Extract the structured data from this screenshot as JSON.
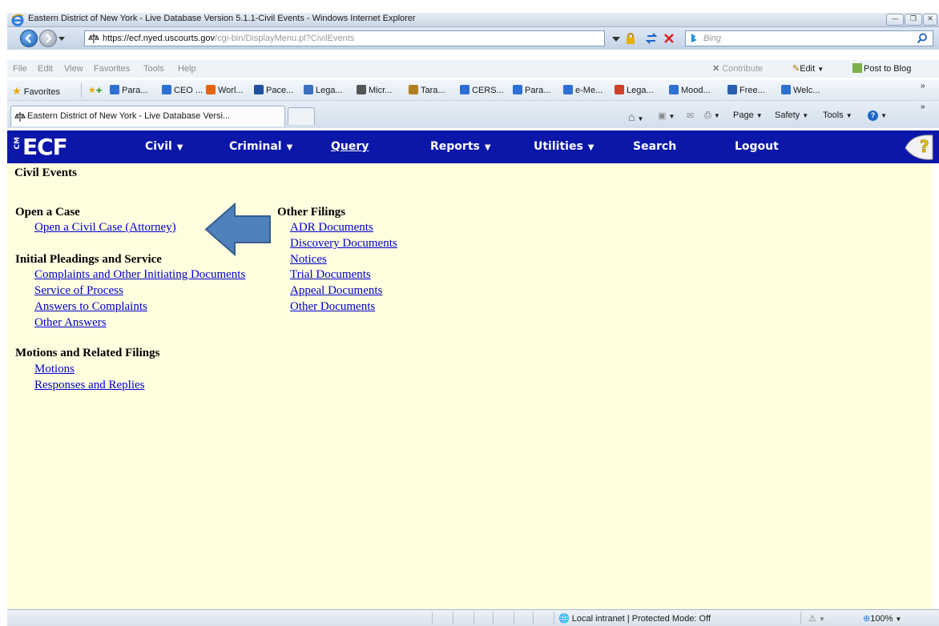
{
  "window": {
    "title": "Eastern District of New York - Live Database Version 5.1.1-Civil Events - Windows Internet Explorer"
  },
  "address": {
    "url_host": "https://ecf.nyed.uscourts.gov",
    "url_path": "/cgi-bin/DisplayMenu.pl?CivilEvents",
    "search_placeholder": "Bing"
  },
  "menu": {
    "items": [
      "File",
      "Edit",
      "View",
      "Favorites",
      "Tools",
      "Help"
    ],
    "contribute": "Contribute",
    "edit": "Edit",
    "post_to_blog": "Post to Blog"
  },
  "favorites": {
    "label": "Favorites",
    "items": [
      "Para...",
      "CEO ...",
      "Worl...",
      "Pace...",
      "Lega...",
      "Micr...",
      "Tara...",
      "CERS...",
      "Para...",
      "e-Me...",
      "Lega...",
      "Mood...",
      "Free...",
      "Welc..."
    ],
    "icon_colors": [
      "#2e6fd3",
      "#2e6fd3",
      "#e8640c",
      "#1e4fa0",
      "#3a6fc0",
      "#555555",
      "#b08020",
      "#2e6fd3",
      "#2e6fd3",
      "#2e6fd3",
      "#d0402a",
      "#2e6fd3",
      "#2a5fb0",
      "#2e6fd3"
    ]
  },
  "tab": {
    "title": "Eastern District of New York - Live Database Versi..."
  },
  "commandbar": {
    "page": "Page",
    "safety": "Safety",
    "tools": "Tools"
  },
  "ecf": {
    "logo_small": "CM",
    "logo": "ECF",
    "nav": {
      "civil": "Civil",
      "criminal": "Criminal",
      "query": "Query",
      "reports": "Reports",
      "utilities": "Utilities",
      "search": "Search",
      "logout": "Logout"
    }
  },
  "content": {
    "heading": "Civil Events",
    "open_case": {
      "title": "Open a Case",
      "links": [
        "Open a Civil Case (Attorney)"
      ]
    },
    "initial_pleadings": {
      "title": "Initial Pleadings and Service",
      "links": [
        "Complaints and Other Initiating Documents",
        "Service of Process",
        "Answers to Complaints",
        "Other Answers"
      ]
    },
    "motions": {
      "title": "Motions and Related Filings",
      "links": [
        "Motions",
        "Responses and Replies"
      ]
    },
    "other_filings": {
      "title": "Other Filings",
      "links": [
        "ADR Documents",
        "Discovery Documents",
        "Notices",
        "Trial Documents",
        "Appeal Documents",
        "Other Documents"
      ]
    },
    "arrow_color": "#4f81bd"
  },
  "status": {
    "zone": "Local intranet | Protected Mode: Off",
    "zoom": "100%"
  },
  "colors": {
    "ecf_bar": "#0a17a8",
    "content_bg": "#ffffe0",
    "link": "#0000cc"
  }
}
